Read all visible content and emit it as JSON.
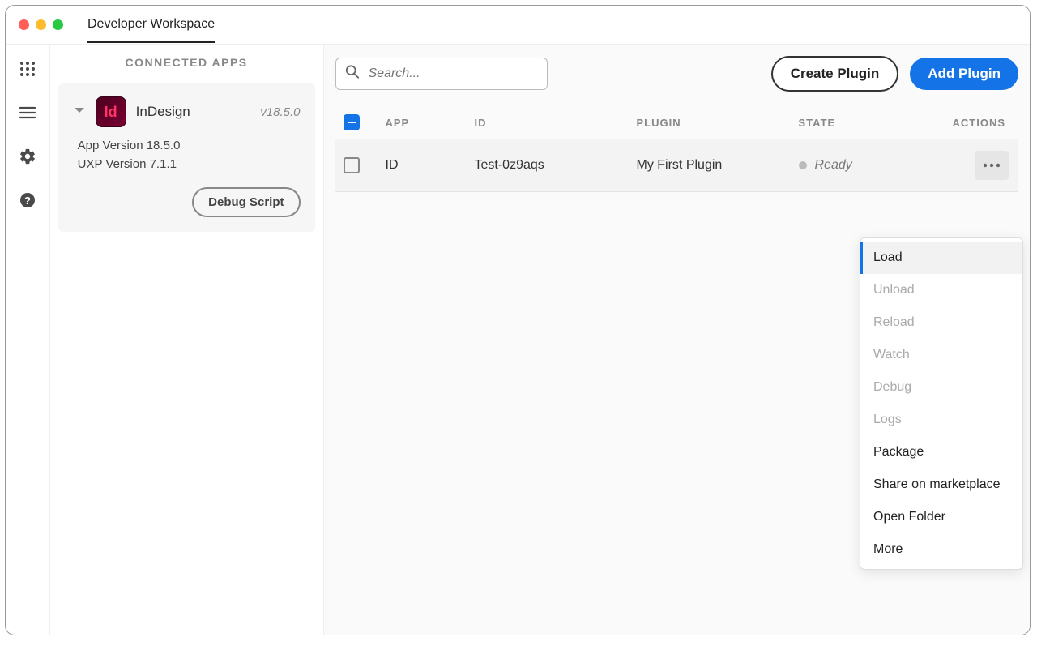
{
  "window": {
    "title": "Developer Workspace"
  },
  "sidebar": {
    "heading": "CONNECTED APPS",
    "app": {
      "name": "InDesign",
      "abbr": "Id",
      "version": "v18.5.0",
      "appVersionLine": "App Version 18.5.0",
      "uxpVersionLine": "UXP Version 7.1.1",
      "debugButton": "Debug Script"
    }
  },
  "toolbar": {
    "searchPlaceholder": "Search...",
    "createPlugin": "Create Plugin",
    "addPlugin": "Add Plugin"
  },
  "table": {
    "headers": {
      "app": "APP",
      "id": "ID",
      "plugin": "PLUGIN",
      "state": "STATE",
      "actions": "ACTIONS"
    },
    "row": {
      "app": "ID",
      "id": "Test-0z9aqs",
      "plugin": "My First Plugin",
      "state": "Ready"
    }
  },
  "menu": {
    "items": [
      {
        "label": "Load",
        "enabled": true,
        "selected": true
      },
      {
        "label": "Unload",
        "enabled": false
      },
      {
        "label": "Reload",
        "enabled": false
      },
      {
        "label": "Watch",
        "enabled": false
      },
      {
        "label": "Debug",
        "enabled": false
      },
      {
        "label": "Logs",
        "enabled": false
      },
      {
        "label": "Package",
        "enabled": true
      },
      {
        "label": "Share on marketplace",
        "enabled": true
      },
      {
        "label": "Open Folder",
        "enabled": true
      },
      {
        "label": "More",
        "enabled": true
      }
    ]
  }
}
